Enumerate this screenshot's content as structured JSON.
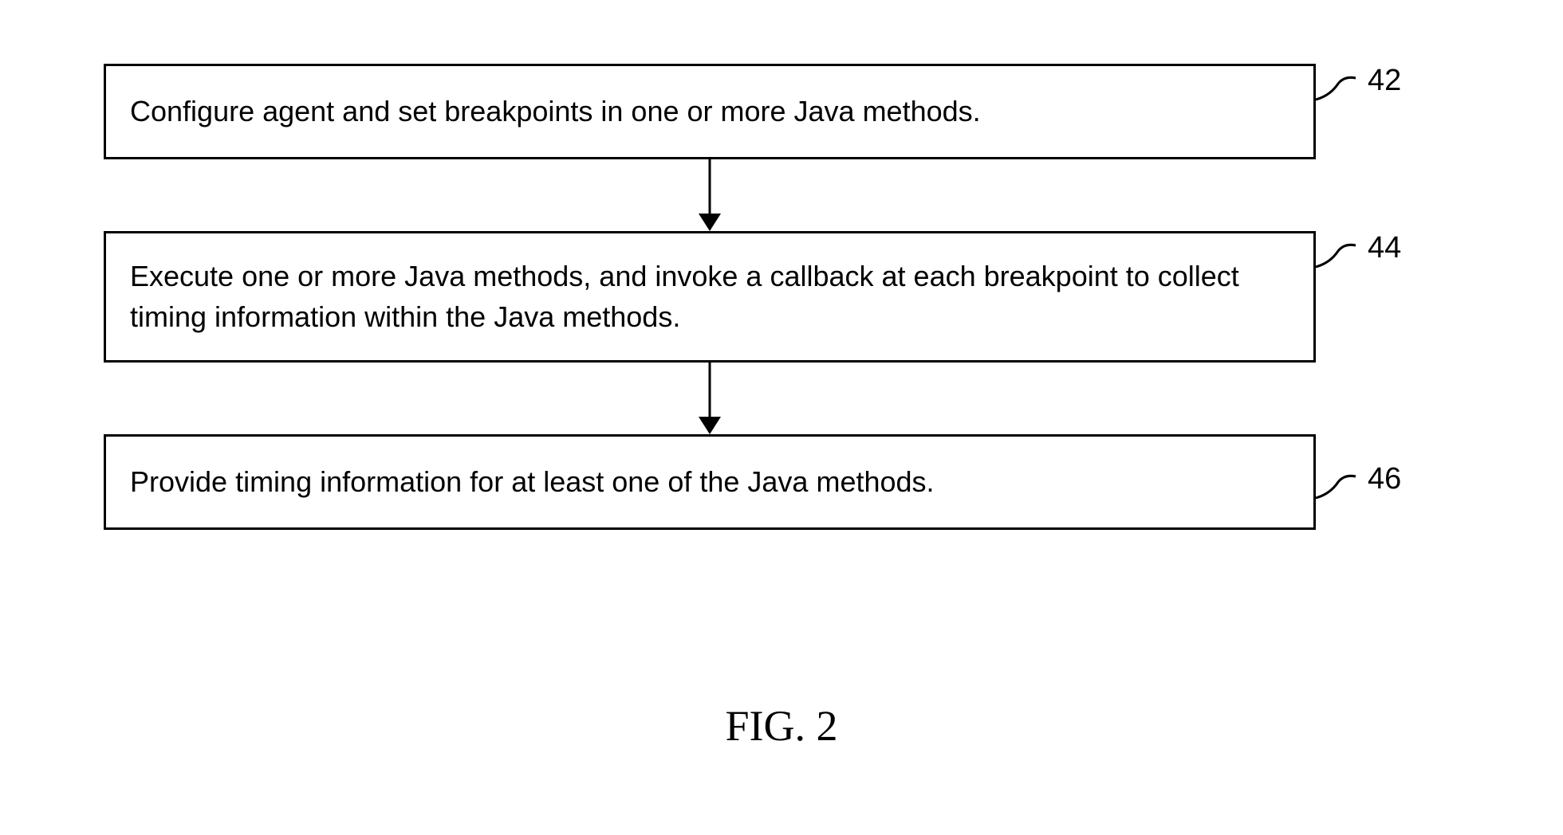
{
  "flowchart": {
    "steps": [
      {
        "text": "Configure agent and set breakpoints in one or more Java methods.",
        "ref": "42"
      },
      {
        "text": "Execute one or more Java methods, and invoke a callback at each breakpoint to collect timing information within the Java methods.",
        "ref": "44"
      },
      {
        "text": "Provide timing information for at least one of the Java methods.",
        "ref": "46"
      }
    ]
  },
  "figure_label": "FIG. 2"
}
